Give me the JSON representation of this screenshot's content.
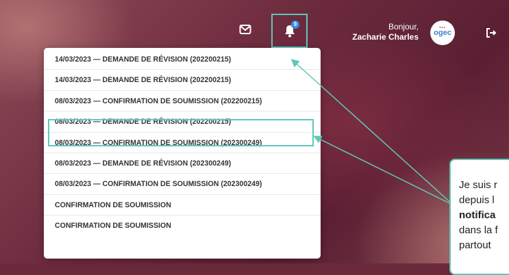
{
  "header": {
    "greeting_line1": "Bonjour,",
    "user_name": "Zacharie Charles",
    "notification_count": "9",
    "avatar_text": "ogec",
    "icons": [
      "mail-icon",
      "bell-icon",
      "logout-icon"
    ]
  },
  "notifications": [
    {
      "label": "14/03/2023 — DEMANDE DE RÉVISION (202200215)"
    },
    {
      "label": "14/03/2023 — DEMANDE DE RÉVISION (202200215)"
    },
    {
      "label": "08/03/2023 — CONFIRMATION DE SOUMISSION (202200215)"
    },
    {
      "label": "08/03/2023 — DEMANDE DE RÉVISION (202200215)"
    },
    {
      "label": "08/03/2023 — CONFIRMATION DE SOUMISSION (202300249)"
    },
    {
      "label": "08/03/2023 — DEMANDE DE RÉVISION (202300249)"
    },
    {
      "label": "08/03/2023 — CONFIRMATION DE SOUMISSION (202300249)"
    },
    {
      "label": "CONFIRMATION DE SOUMISSION"
    },
    {
      "label": "CONFIRMATION DE SOUMISSION"
    }
  ],
  "callout": {
    "line1": "Je suis r",
    "line2": "depuis l",
    "line3_bold": "notifica",
    "line4": "dans la f",
    "line5": "partout"
  },
  "colors": {
    "accent": "#5fc7b8",
    "badge": "#3b8de0"
  }
}
